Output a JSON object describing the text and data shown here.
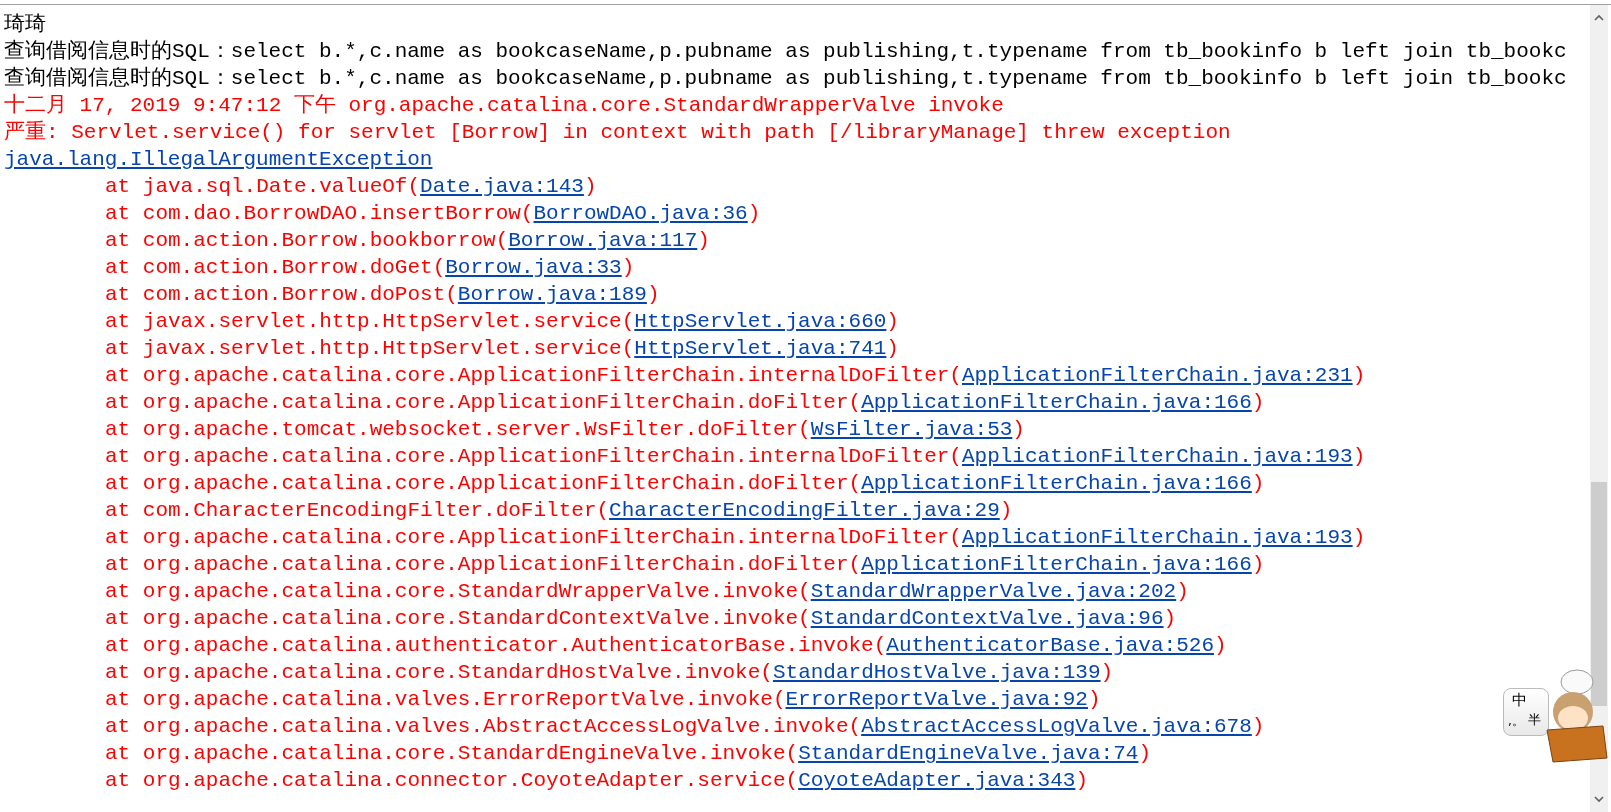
{
  "console": {
    "lines": [
      {
        "kind": "plain",
        "text": "琦琦"
      },
      {
        "kind": "plain",
        "text": "查询借阅信息时的SQL：select b.*,c.name as bookcaseName,p.pubname as publishing,t.typename from tb_bookinfo b left join tb_bookc"
      },
      {
        "kind": "plain",
        "text": "查询借阅信息时的SQL：select b.*,c.name as bookcaseName,p.pubname as publishing,t.typename from tb_bookinfo b left join tb_bookc"
      },
      {
        "kind": "error",
        "text": "十二月 17, 2019 9:47:12 下午 org.apache.catalina.core.StandardWrapperValve invoke"
      },
      {
        "kind": "error",
        "text": "严重: Servlet.service() for servlet [Borrow] in context with path [/libraryManage] threw exception"
      },
      {
        "kind": "exception",
        "text": "java.lang.IllegalArgumentException"
      },
      {
        "kind": "frame",
        "prefix": "at java.sql.Date.valueOf(",
        "link": "Date.java:143",
        "suffix": ")"
      },
      {
        "kind": "frame",
        "prefix": "at com.dao.BorrowDAO.insertBorrow(",
        "link": "BorrowDAO.java:36",
        "suffix": ")"
      },
      {
        "kind": "frame",
        "prefix": "at com.action.Borrow.bookborrow(",
        "link": "Borrow.java:117",
        "suffix": ")"
      },
      {
        "kind": "frame",
        "prefix": "at com.action.Borrow.doGet(",
        "link": "Borrow.java:33",
        "suffix": ")"
      },
      {
        "kind": "frame",
        "prefix": "at com.action.Borrow.doPost(",
        "link": "Borrow.java:189",
        "suffix": ")"
      },
      {
        "kind": "frame",
        "prefix": "at javax.servlet.http.HttpServlet.service(",
        "link": "HttpServlet.java:660",
        "suffix": ")"
      },
      {
        "kind": "frame",
        "prefix": "at javax.servlet.http.HttpServlet.service(",
        "link": "HttpServlet.java:741",
        "suffix": ")"
      },
      {
        "kind": "frame",
        "prefix": "at org.apache.catalina.core.ApplicationFilterChain.internalDoFilter(",
        "link": "ApplicationFilterChain.java:231",
        "suffix": ")"
      },
      {
        "kind": "frame",
        "prefix": "at org.apache.catalina.core.ApplicationFilterChain.doFilter(",
        "link": "ApplicationFilterChain.java:166",
        "suffix": ")"
      },
      {
        "kind": "frame",
        "prefix": "at org.apache.tomcat.websocket.server.WsFilter.doFilter(",
        "link": "WsFilter.java:53",
        "suffix": ")"
      },
      {
        "kind": "frame",
        "prefix": "at org.apache.catalina.core.ApplicationFilterChain.internalDoFilter(",
        "link": "ApplicationFilterChain.java:193",
        "suffix": ")"
      },
      {
        "kind": "frame",
        "prefix": "at org.apache.catalina.core.ApplicationFilterChain.doFilter(",
        "link": "ApplicationFilterChain.java:166",
        "suffix": ")"
      },
      {
        "kind": "frame",
        "prefix": "at com.CharacterEncodingFilter.doFilter(",
        "link": "CharacterEncodingFilter.java:29",
        "suffix": ")"
      },
      {
        "kind": "frame",
        "prefix": "at org.apache.catalina.core.ApplicationFilterChain.internalDoFilter(",
        "link": "ApplicationFilterChain.java:193",
        "suffix": ")"
      },
      {
        "kind": "frame",
        "prefix": "at org.apache.catalina.core.ApplicationFilterChain.doFilter(",
        "link": "ApplicationFilterChain.java:166",
        "suffix": ")"
      },
      {
        "kind": "frame",
        "prefix": "at org.apache.catalina.core.StandardWrapperValve.invoke(",
        "link": "StandardWrapperValve.java:202",
        "suffix": ")"
      },
      {
        "kind": "frame",
        "prefix": "at org.apache.catalina.core.StandardContextValve.invoke(",
        "link": "StandardContextValve.java:96",
        "suffix": ")"
      },
      {
        "kind": "frame",
        "prefix": "at org.apache.catalina.authenticator.AuthenticatorBase.invoke(",
        "link": "AuthenticatorBase.java:526",
        "suffix": ")"
      },
      {
        "kind": "frame",
        "prefix": "at org.apache.catalina.core.StandardHostValve.invoke(",
        "link": "StandardHostValve.java:139",
        "suffix": ")"
      },
      {
        "kind": "frame",
        "prefix": "at org.apache.catalina.valves.ErrorReportValve.invoke(",
        "link": "ErrorReportValve.java:92",
        "suffix": ")"
      },
      {
        "kind": "frame",
        "prefix": "at org.apache.catalina.valves.AbstractAccessLogValve.invoke(",
        "link": "AbstractAccessLogValve.java:678",
        "suffix": ")"
      },
      {
        "kind": "frame",
        "prefix": "at org.apache.catalina.core.StandardEngineValve.invoke(",
        "link": "StandardEngineValve.java:74",
        "suffix": ")"
      },
      {
        "kind": "frame",
        "prefix": "at org.apache.catalina.connector.CoyoteAdapter.service(",
        "link": "CoyoteAdapter.java:343",
        "suffix": ")"
      }
    ]
  },
  "ime_status": {
    "mode": "中",
    "punctuation": ",。",
    "width": "半"
  }
}
